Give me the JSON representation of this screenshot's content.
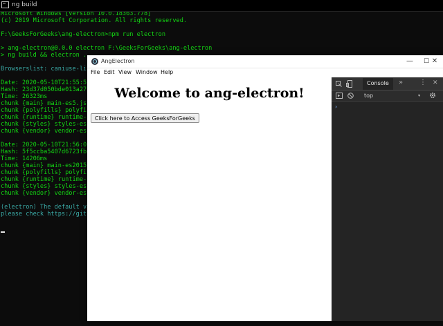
{
  "terminal": {
    "title": "ng build",
    "lines": [
      {
        "text": "Microsoft Windows [Version 10.0.18363.778]",
        "style": "green"
      },
      {
        "text": "(c) 2019 Microsoft Corporation. All rights reserved.",
        "style": "green"
      },
      {
        "text": "",
        "style": "green"
      },
      {
        "text": "F:\\GeeksForGeeks\\ang-electron>npm run electron",
        "style": "green"
      },
      {
        "text": "",
        "style": "green"
      },
      {
        "text": "> ang-electron@0.0.0 electron F:\\GeeksForGeeks\\ang-electron",
        "style": "green"
      },
      {
        "text": "> ng build && electron .",
        "style": "green"
      },
      {
        "text": "",
        "style": "green"
      },
      {
        "text": "Browserslist: caniuse-lit",
        "style": "teal"
      },
      {
        "text": "",
        "style": "green"
      },
      {
        "text": "Date: 2020-05-10T21:55:5",
        "style": "green"
      },
      {
        "text": "Hash: 23d37d050bde013a27",
        "style": "green"
      },
      {
        "text": "Time: 26323ms",
        "style": "green"
      },
      {
        "text": "chunk {main} main-es5.js",
        "style": "green"
      },
      {
        "text": "chunk {polyfills} polyfil",
        "style": "green"
      },
      {
        "text": "chunk {runtime} runtime-",
        "style": "green"
      },
      {
        "text": "chunk {styles} styles-es",
        "style": "green"
      },
      {
        "text": "chunk {vendor} vendor-es",
        "style": "green"
      },
      {
        "text": "",
        "style": "green"
      },
      {
        "text": "Date: 2020-05-10T21:56:0",
        "style": "green"
      },
      {
        "text": "Hash: 5f5ccba5407d6723fb",
        "style": "green"
      },
      {
        "text": "Time: 14206ms",
        "style": "green"
      },
      {
        "text": "chunk {main} main-es2015",
        "style": "green"
      },
      {
        "text": "chunk {polyfills} polyfil",
        "style": "green"
      },
      {
        "text": "chunk {runtime} runtime-",
        "style": "green"
      },
      {
        "text": "chunk {styles} styles-es",
        "style": "green"
      },
      {
        "text": "chunk {vendor} vendor-es",
        "style": "green"
      },
      {
        "text": "",
        "style": "green"
      },
      {
        "text": "(electron) The default va",
        "style": "teal"
      },
      {
        "text": "please check https://git",
        "style": "teal"
      }
    ]
  },
  "electron": {
    "title": "AngElectron",
    "window_buttons": {
      "minimize": "—",
      "maximize": "☐",
      "close": "✕"
    },
    "menu": [
      "File",
      "Edit",
      "View",
      "Window",
      "Help"
    ],
    "heading": "Welcome to ang-electron!",
    "button_label": "Click here to Access GeeksForGeeks"
  },
  "devtools": {
    "tab": "Console",
    "more": "»",
    "menu": "⋮",
    "close": "✕",
    "context": "top",
    "context_arrow": "▾",
    "prompt": "›"
  },
  "colors": {
    "terminal_green": "#13d613",
    "terminal_teal": "#3aa9a5",
    "terminal_bg": "#0c0c0c",
    "devtools_bg": "#242424"
  }
}
